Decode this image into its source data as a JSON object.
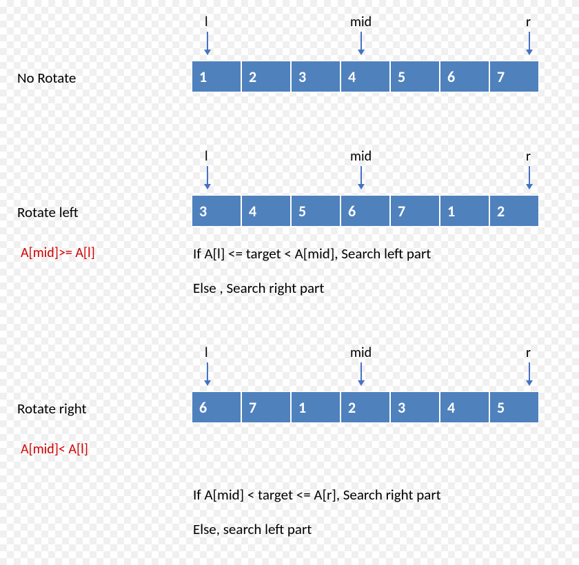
{
  "sections": [
    {
      "title": "No Rotate",
      "condition": "",
      "pointers": {
        "l": "l",
        "mid": "mid",
        "r": "r"
      },
      "cells": [
        "1",
        "2",
        "3",
        "4",
        "5",
        "6",
        "7"
      ],
      "rule1": "",
      "rule2": ""
    },
    {
      "title": "Rotate left",
      "condition": "A[mid]>= A[l]",
      "pointers": {
        "l": "l",
        "mid": "mid",
        "r": "r"
      },
      "cells": [
        "3",
        "4",
        "5",
        "6",
        "7",
        "1",
        "2"
      ],
      "rule1": "If  A[l] <= target < A[mid], Search left part",
      "rule2": "Else , Search right part"
    },
    {
      "title": "Rotate right",
      "condition": "A[mid]< A[l]",
      "pointers": {
        "l": "l",
        "mid": "mid",
        "r": "r"
      },
      "cells": [
        "6",
        "7",
        "1",
        "2",
        "3",
        "4",
        "5"
      ],
      "rule1": "If  A[mid] < target <= A[r], Search right part",
      "rule2": "Else, search left part"
    }
  ]
}
